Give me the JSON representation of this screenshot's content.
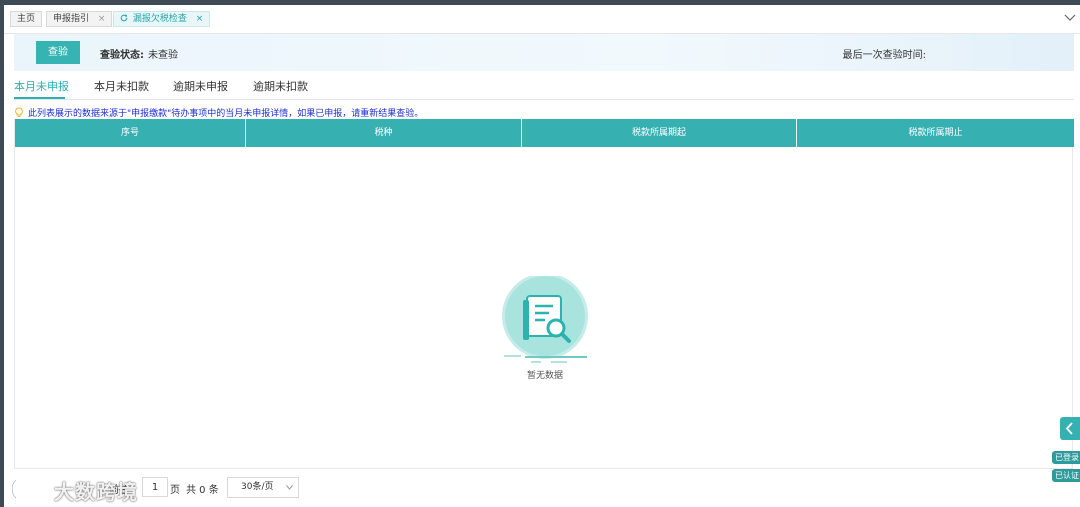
{
  "tabs": [
    {
      "label": "主页",
      "closable": false,
      "active": false
    },
    {
      "label": "申报指引",
      "closable": true,
      "active": false
    },
    {
      "label": "漏报欠税检查",
      "closable": true,
      "active": true
    }
  ],
  "close_glyph": "×",
  "status": {
    "button_label": "查验",
    "state_label": "查验状态:",
    "state_value": "未查验",
    "last_check_label": "最后一次查验时间:"
  },
  "subtabs": [
    {
      "label": "本月未申报",
      "active": true
    },
    {
      "label": "本月未扣款",
      "active": false
    },
    {
      "label": "逾期未申报",
      "active": false
    },
    {
      "label": "逾期未扣款",
      "active": false
    }
  ],
  "notice": "此列表展示的数据来源于\"申报缴款\"待办事项中的当月未申报详情，如果已申报，请重新结果查验。",
  "table": {
    "columns": [
      "序号",
      "税种",
      "税款所属期起",
      "税款所属期止"
    ],
    "rows": [],
    "empty_text": "暂无数据"
  },
  "pagination": {
    "prefix": "前往",
    "current_page": "1",
    "suffix": "页",
    "total": "共 0 条",
    "page_size": "30条/页"
  },
  "watermark": "大数跨境",
  "side": {
    "badges": [
      "已登录",
      "已认证"
    ]
  },
  "colors": {
    "primary": "#36b3b3",
    "table_header": "#37b0b2",
    "notice_text": "#1e2fcf"
  }
}
